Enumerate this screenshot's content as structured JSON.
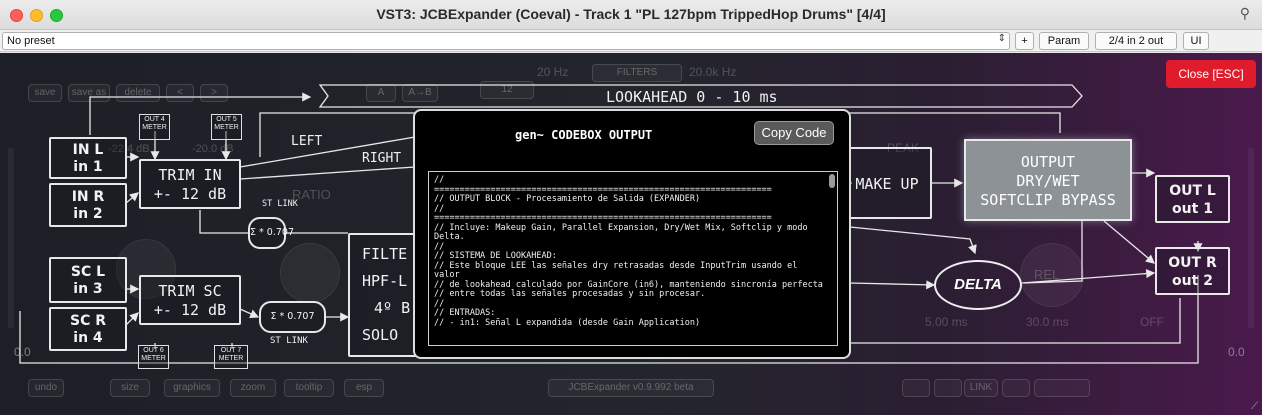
{
  "window": {
    "title": "VST3: JCBExpander (Coeval) - Track 1 \"PL 127bpm TrippedHop Drums\" [4/4]"
  },
  "toolbar": {
    "preset": "No preset",
    "plus_label": "+",
    "param_label": "Param",
    "io_label": "2/4 in 2 out",
    "ui_label": "UI",
    "checkbox_mark": "✓"
  },
  "plugin": {
    "close_label": "Close [ESC]",
    "lookahead_label": "LOOKAHEAD 0 - 10 ms",
    "blocks": {
      "in_l": [
        "IN L",
        "in 1"
      ],
      "in_r": [
        "IN R",
        "in 2"
      ],
      "sc_l": [
        "SC L",
        "in 3"
      ],
      "sc_r": [
        "SC R",
        "in 4"
      ],
      "trim_in": [
        "TRIM IN",
        "+- 12 dB"
      ],
      "trim_sc": [
        "TRIM SC",
        "+- 12 dB"
      ],
      "st_link_1": "ST LINK",
      "sum_1": "Σ * 0.707",
      "st_link_2": "ST LINK",
      "sum_2": "Σ * 0.707",
      "filter": [
        "FILTE",
        "HPF-L",
        "4º B",
        "SOLO"
      ],
      "make_up": "MAKE UP",
      "output": [
        "OUTPUT",
        "DRY/WET",
        "SOFTCLIP BYPASS"
      ],
      "out_l": [
        "OUT L",
        "out 1"
      ],
      "out_r": [
        "OUT R",
        "out 2"
      ],
      "delta": "DELTA",
      "left": "LEFT",
      "right": "RIGHT",
      "meters": {
        "out4": [
          "OUT 4",
          "METER"
        ],
        "out5": [
          "OUT 5",
          "METER"
        ],
        "out6": [
          "OUT 6",
          "METER"
        ],
        "out7": [
          "OUT 7",
          "METER"
        ]
      }
    },
    "ghost": {
      "hz_low": "20 Hz",
      "filters": "FILTERS",
      "hz_high": "20.0k Hz",
      "save": "save",
      "save_as": "save as",
      "delete": "delete",
      "prev": "<",
      "next": ">",
      "a": "A",
      "a_b": "A→B",
      "twelve": "12",
      "db1": "-22.4 dB",
      "db2": "-20.0 dB",
      "ratio": "RATIO",
      "peak": "PEAK",
      "rel": "REL",
      "ms1": "5.00 ms",
      "ms2": "30.0 ms",
      "off": "OFF",
      "zero_left": "0.0",
      "zero_right": "0.0",
      "undo": "undo",
      "size": "size",
      "graphics": "graphics",
      "zoom": "zoom",
      "tooltip": "tooltip",
      "esp": "esp",
      "version": "JCBExpander v0.9.992 beta",
      "link": "LINK"
    },
    "modal": {
      "title": "gen~ CODEBOX OUTPUT",
      "copy_label": "Copy Code",
      "code": "//\n==================================================================\n// OUTPUT BLOCK - Procesamiento de Salida (EXPANDER)\n//\n==================================================================\n// Incluye: Makeup Gain, Parallel Expansion, Dry/Wet Mix, Softclip y modo Delta.\n//\n// SISTEMA DE LOOKAHEAD:\n// Este bloque LEE las señales dry retrasadas desde InputTrim usando el valor\n// de lookahead calculado por GainCore (in6), manteniendo sincronía perfecta\n// entre todas las señales procesadas y sin procesar.\n//\n// ENTRADAS:\n// - in1: Señal L expandida (desde Gain Application)"
    }
  }
}
